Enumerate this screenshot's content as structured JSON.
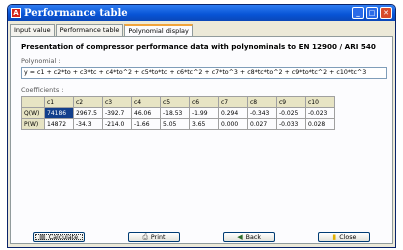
{
  "window": {
    "title": "Performance table",
    "app_icon_letter": "A"
  },
  "tabs": [
    {
      "label": "Input value"
    },
    {
      "label": "Performance table"
    },
    {
      "label": "Polynomial display"
    }
  ],
  "panel": {
    "heading": "Presentation of compressor performance data with polynominals to EN 12900 / ARI 540",
    "polynomial_label": "Polynomial :",
    "polynomial_value": "y = c1 + c2*to + c3*tc + c4*to^2 + c5*to*tc + c6*tc^2 + c7*to^3 + c8*tc*to^2 + c9*to*tc^2 + c10*tc^3",
    "coefficients_label": "Coefficients :"
  },
  "table": {
    "columns": [
      "c1",
      "c2",
      "c3",
      "c4",
      "c5",
      "c6",
      "c7",
      "c8",
      "c9",
      "c10"
    ],
    "rows": [
      {
        "label": "Q(W)",
        "values": [
          "74186",
          "2967.5",
          "-392.7",
          "46.06",
          "-18.53",
          "-1.99",
          "0.294",
          "-0.343",
          "-0.025",
          "-0.023"
        ]
      },
      {
        "label": "P(W)",
        "values": [
          "14872",
          "-34.3",
          "-214.0",
          "-1.66",
          "5.05",
          "3.65",
          "0.000",
          "0.027",
          "-0.033",
          "0.028"
        ]
      }
    ]
  },
  "buttons": {
    "calculate": "Calculate",
    "print": "Print",
    "back": "Back",
    "close": "Close"
  }
}
